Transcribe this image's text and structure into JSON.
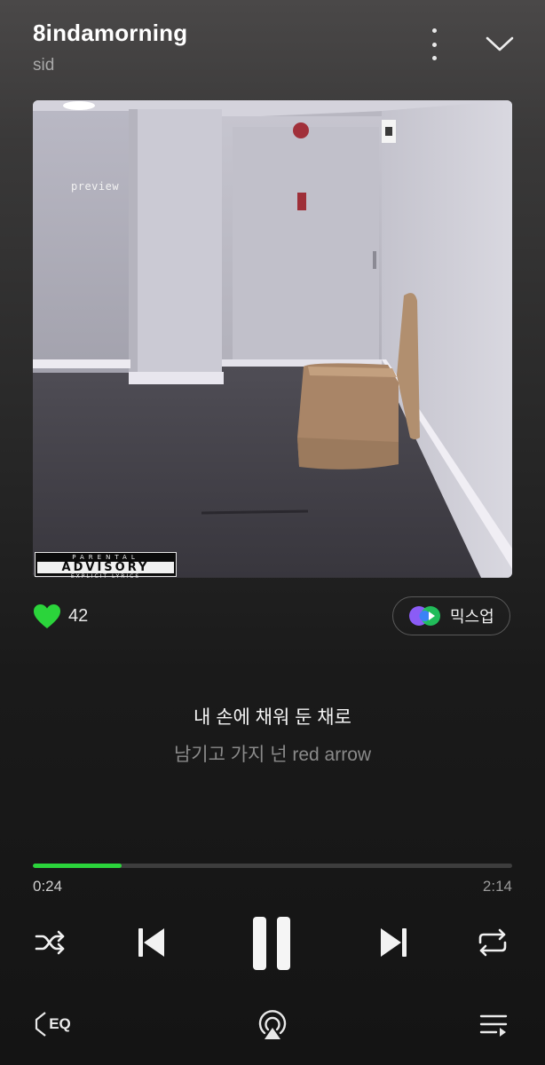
{
  "track": {
    "title": "8indamorning",
    "artist": "sid"
  },
  "artwork": {
    "preview_text": "preview",
    "advisory": {
      "line1": "PARENTAL",
      "line2": "ADVISORY",
      "line3": "EXPLICIT LYRICS"
    }
  },
  "like": {
    "count": "42",
    "liked": true,
    "color": "#2bd43b"
  },
  "mixup": {
    "label": "믹스업"
  },
  "lyrics": {
    "current": "내 손에 채워 둔 채로",
    "next": "남기고 가지 넌 red arrow"
  },
  "playback": {
    "current_time": "0:24",
    "total_time": "2:14",
    "progress_fraction": 0.186,
    "accent": "#2bd43b",
    "state": "playing"
  },
  "icons": {
    "more": "more-vertical-icon",
    "collapse": "chevron-down-icon",
    "heart": "heart-icon",
    "shuffle": "shuffle-icon",
    "previous": "skip-previous-icon",
    "pause": "pause-icon",
    "next": "skip-next-icon",
    "repeat": "repeat-icon",
    "eq": "equalizer-icon",
    "airplay": "airplay-icon",
    "queue": "queue-list-icon"
  },
  "bottom": {
    "eq_label": "EQ"
  }
}
